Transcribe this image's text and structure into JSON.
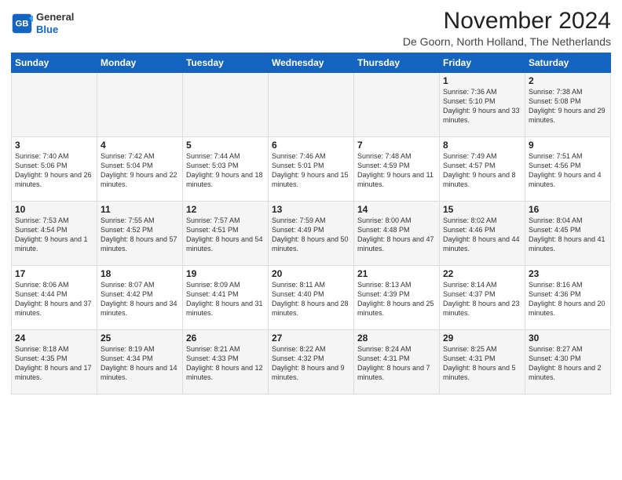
{
  "header": {
    "logo_line1": "General",
    "logo_line2": "Blue",
    "title": "November 2024",
    "location": "De Goorn, North Holland, The Netherlands"
  },
  "days_of_week": [
    "Sunday",
    "Monday",
    "Tuesday",
    "Wednesday",
    "Thursday",
    "Friday",
    "Saturday"
  ],
  "weeks": [
    [
      {
        "day": "",
        "info": ""
      },
      {
        "day": "",
        "info": ""
      },
      {
        "day": "",
        "info": ""
      },
      {
        "day": "",
        "info": ""
      },
      {
        "day": "",
        "info": ""
      },
      {
        "day": "1",
        "info": "Sunrise: 7:36 AM\nSunset: 5:10 PM\nDaylight: 9 hours and 33 minutes."
      },
      {
        "day": "2",
        "info": "Sunrise: 7:38 AM\nSunset: 5:08 PM\nDaylight: 9 hours and 29 minutes."
      }
    ],
    [
      {
        "day": "3",
        "info": "Sunrise: 7:40 AM\nSunset: 5:06 PM\nDaylight: 9 hours and 26 minutes."
      },
      {
        "day": "4",
        "info": "Sunrise: 7:42 AM\nSunset: 5:04 PM\nDaylight: 9 hours and 22 minutes."
      },
      {
        "day": "5",
        "info": "Sunrise: 7:44 AM\nSunset: 5:03 PM\nDaylight: 9 hours and 18 minutes."
      },
      {
        "day": "6",
        "info": "Sunrise: 7:46 AM\nSunset: 5:01 PM\nDaylight: 9 hours and 15 minutes."
      },
      {
        "day": "7",
        "info": "Sunrise: 7:48 AM\nSunset: 4:59 PM\nDaylight: 9 hours and 11 minutes."
      },
      {
        "day": "8",
        "info": "Sunrise: 7:49 AM\nSunset: 4:57 PM\nDaylight: 9 hours and 8 minutes."
      },
      {
        "day": "9",
        "info": "Sunrise: 7:51 AM\nSunset: 4:56 PM\nDaylight: 9 hours and 4 minutes."
      }
    ],
    [
      {
        "day": "10",
        "info": "Sunrise: 7:53 AM\nSunset: 4:54 PM\nDaylight: 9 hours and 1 minute."
      },
      {
        "day": "11",
        "info": "Sunrise: 7:55 AM\nSunset: 4:52 PM\nDaylight: 8 hours and 57 minutes."
      },
      {
        "day": "12",
        "info": "Sunrise: 7:57 AM\nSunset: 4:51 PM\nDaylight: 8 hours and 54 minutes."
      },
      {
        "day": "13",
        "info": "Sunrise: 7:59 AM\nSunset: 4:49 PM\nDaylight: 8 hours and 50 minutes."
      },
      {
        "day": "14",
        "info": "Sunrise: 8:00 AM\nSunset: 4:48 PM\nDaylight: 8 hours and 47 minutes."
      },
      {
        "day": "15",
        "info": "Sunrise: 8:02 AM\nSunset: 4:46 PM\nDaylight: 8 hours and 44 minutes."
      },
      {
        "day": "16",
        "info": "Sunrise: 8:04 AM\nSunset: 4:45 PM\nDaylight: 8 hours and 41 minutes."
      }
    ],
    [
      {
        "day": "17",
        "info": "Sunrise: 8:06 AM\nSunset: 4:44 PM\nDaylight: 8 hours and 37 minutes."
      },
      {
        "day": "18",
        "info": "Sunrise: 8:07 AM\nSunset: 4:42 PM\nDaylight: 8 hours and 34 minutes."
      },
      {
        "day": "19",
        "info": "Sunrise: 8:09 AM\nSunset: 4:41 PM\nDaylight: 8 hours and 31 minutes."
      },
      {
        "day": "20",
        "info": "Sunrise: 8:11 AM\nSunset: 4:40 PM\nDaylight: 8 hours and 28 minutes."
      },
      {
        "day": "21",
        "info": "Sunrise: 8:13 AM\nSunset: 4:39 PM\nDaylight: 8 hours and 25 minutes."
      },
      {
        "day": "22",
        "info": "Sunrise: 8:14 AM\nSunset: 4:37 PM\nDaylight: 8 hours and 23 minutes."
      },
      {
        "day": "23",
        "info": "Sunrise: 8:16 AM\nSunset: 4:36 PM\nDaylight: 8 hours and 20 minutes."
      }
    ],
    [
      {
        "day": "24",
        "info": "Sunrise: 8:18 AM\nSunset: 4:35 PM\nDaylight: 8 hours and 17 minutes."
      },
      {
        "day": "25",
        "info": "Sunrise: 8:19 AM\nSunset: 4:34 PM\nDaylight: 8 hours and 14 minutes."
      },
      {
        "day": "26",
        "info": "Sunrise: 8:21 AM\nSunset: 4:33 PM\nDaylight: 8 hours and 12 minutes."
      },
      {
        "day": "27",
        "info": "Sunrise: 8:22 AM\nSunset: 4:32 PM\nDaylight: 8 hours and 9 minutes."
      },
      {
        "day": "28",
        "info": "Sunrise: 8:24 AM\nSunset: 4:31 PM\nDaylight: 8 hours and 7 minutes."
      },
      {
        "day": "29",
        "info": "Sunrise: 8:25 AM\nSunset: 4:31 PM\nDaylight: 8 hours and 5 minutes."
      },
      {
        "day": "30",
        "info": "Sunrise: 8:27 AM\nSunset: 4:30 PM\nDaylight: 8 hours and 2 minutes."
      }
    ]
  ]
}
